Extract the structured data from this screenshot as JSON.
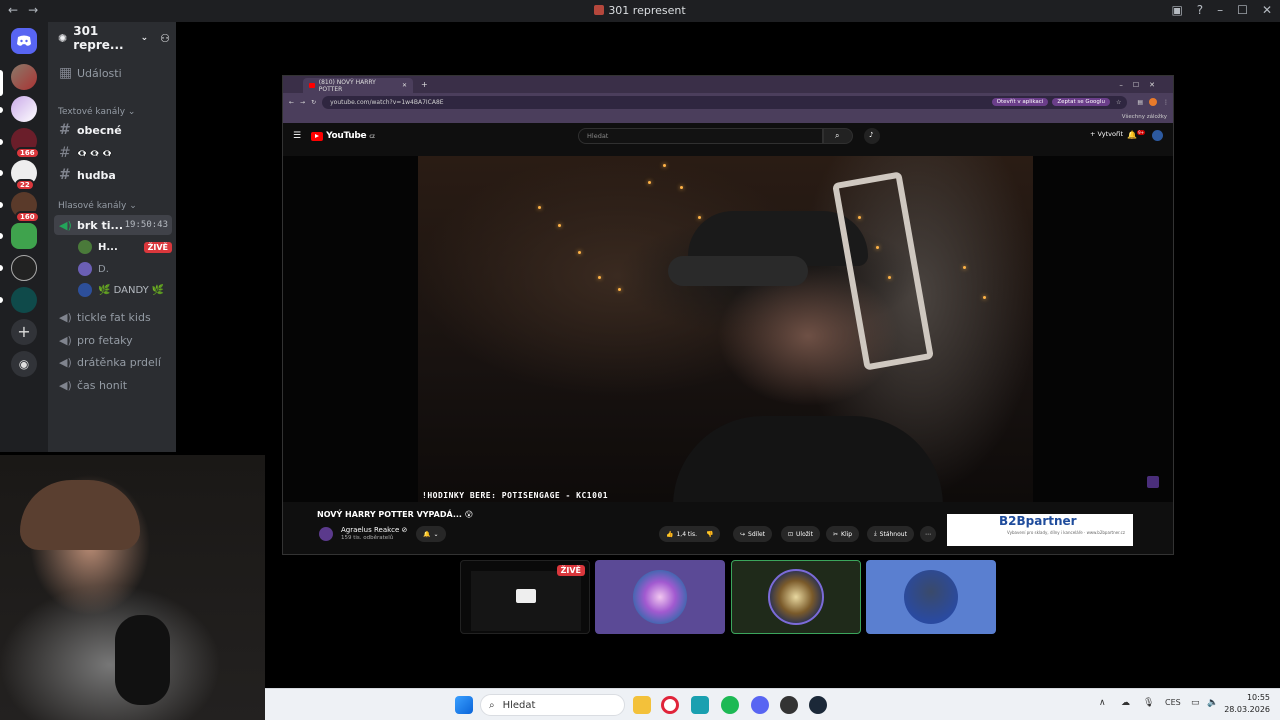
{
  "titlebar": {
    "back": "←",
    "forward": "→",
    "title": "301 represent",
    "min": "–",
    "max": "☐",
    "close": "✕"
  },
  "rail": {
    "badges": [
      "166",
      "22",
      "160"
    ]
  },
  "sidebar": {
    "server_name": "301 repre...",
    "events": "Události",
    "text_category": "Textové kanály",
    "text_channels": [
      {
        "name": "obecné"
      },
      {
        "name": "👁‍🗨 👁‍🗨 👁‍🗨"
      },
      {
        "name": "hudba"
      }
    ],
    "voice_category": "Hlasové kanály",
    "active_voice": {
      "name": "brk ti...",
      "time": "19:50:43"
    },
    "voice_users": [
      {
        "name": "H...",
        "live": "ŽIVĚ",
        "color": "#4a7a3a"
      },
      {
        "name": "D.",
        "color": "#6b5fb5"
      },
      {
        "name": "🌿 DANDY 🌿",
        "color": "#2d4f9a"
      }
    ],
    "voice_channels": [
      {
        "name": "tickle fat kids"
      },
      {
        "name": "pro fetaky"
      },
      {
        "name": "drátěnka prdelí"
      },
      {
        "name": "čas honit"
      }
    ]
  },
  "browser": {
    "tab_title": "(810) NOVÝ HARRY POTTER",
    "url": "youtube.com/watch?v=1w4BA7ICA8E",
    "chip_open": "Otevřít v aplikaci",
    "chip_google": "Zeptat se Googlu",
    "bookmarks": "Všechny záložky",
    "yt_logo": "YouTube",
    "yt_country": "CZ",
    "search_placeholder": "Hledat",
    "create": "Vytvořit",
    "bell_count": "9+",
    "caption": "!HODINKY BERE: POTISENGAGE - KC1001",
    "video_title": "NOVÝ HARRY POTTER VYPADÁ... 😮",
    "channel_name": "Agraelus Reakce ⊘",
    "channel_subs": "159 tis. odběratelů",
    "likes": "1,4 tis.",
    "share": "Sdílet",
    "save": "Uložit",
    "clip": "Klip",
    "download": "Stáhnout",
    "ad_brand": "B2Bpartner",
    "ad_sub": "Vybavení pro sklady, dílny i kanceláře · www.b2bpartner.cz"
  },
  "participants": {
    "live_label": "ŽIVĚ"
  },
  "taskbar": {
    "search": "Hledat",
    "lang": "CES",
    "time": "10:55",
    "date": "28.03.2026"
  },
  "colors": {
    "discord_bg": "#2b2d31",
    "rail_bg": "#1e1f22",
    "live_red": "#da373c",
    "voice_green": "#23a55a"
  }
}
